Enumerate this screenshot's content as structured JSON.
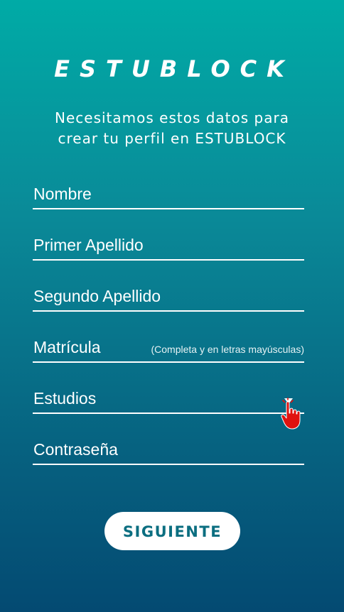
{
  "app": {
    "title": "ESTUBLOCK",
    "subtitle_line1": "Necesitamos estos datos para",
    "subtitle_line2": "crear tu perfil en ESTUBLOCK"
  },
  "form": {
    "nombre_label": "Nombre",
    "primer_apellido_label": "Primer Apellido",
    "segundo_apellido_label": "Segundo Apellido",
    "matricula_label": "Matrícula",
    "matricula_hint": "(Completa y en letras mayúsculas)",
    "estudios_label": "Estudios",
    "contrasena_label": "Contraseña"
  },
  "actions": {
    "next_label": "SIGUIENTE"
  },
  "colors": {
    "gradient_top": "#00aba6",
    "gradient_bottom": "#044a72",
    "button_text": "#0b6e80",
    "cursor": "#e0120f"
  },
  "icons": {
    "dropdown": "chevron-down-icon",
    "cursor": "hand-pointer-icon"
  }
}
